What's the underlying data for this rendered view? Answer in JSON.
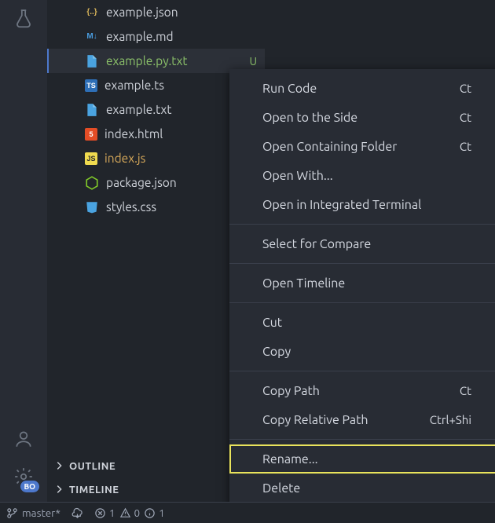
{
  "activity_bar": {
    "top_icon": "flask-icon",
    "bottom_icons": [
      "account-icon",
      "settings-icon"
    ],
    "settings_badge": "BO"
  },
  "files": [
    {
      "name": "example.json",
      "icon": "json",
      "color": "",
      "status": ""
    },
    {
      "name": "example.md",
      "icon": "md",
      "color": "",
      "status": ""
    },
    {
      "name": "example.py.txt",
      "icon": "file",
      "color": "green",
      "status": "U",
      "selected": true
    },
    {
      "name": "example.ts",
      "icon": "ts",
      "color": "",
      "status": ""
    },
    {
      "name": "example.txt",
      "icon": "file",
      "color": "",
      "status": ""
    },
    {
      "name": "index.html",
      "icon": "html",
      "color": "",
      "status": ""
    },
    {
      "name": "index.js",
      "icon": "js",
      "color": "orange",
      "status": ""
    },
    {
      "name": "package.json",
      "icon": "node",
      "color": "",
      "status": ""
    },
    {
      "name": "styles.css",
      "icon": "css",
      "color": "",
      "status": ""
    }
  ],
  "sections": {
    "outline": "OUTLINE",
    "timeline": "TIMELINE"
  },
  "context_menu": [
    {
      "label": "Run Code",
      "shortcut": "Ct"
    },
    {
      "label": "Open to the Side",
      "shortcut": "Ct"
    },
    {
      "label": "Open Containing Folder",
      "shortcut": "Ct"
    },
    {
      "label": "Open With...",
      "shortcut": ""
    },
    {
      "label": "Open in Integrated Terminal",
      "shortcut": ""
    },
    {
      "sep": true
    },
    {
      "label": "Select for Compare",
      "shortcut": ""
    },
    {
      "sep": true
    },
    {
      "label": "Open Timeline",
      "shortcut": ""
    },
    {
      "sep": true
    },
    {
      "label": "Cut",
      "shortcut": ""
    },
    {
      "label": "Copy",
      "shortcut": ""
    },
    {
      "sep": true
    },
    {
      "label": "Copy Path",
      "shortcut": "Ct"
    },
    {
      "label": "Copy Relative Path",
      "shortcut": "Ctrl+Shi"
    },
    {
      "sep": true
    },
    {
      "label": "Rename...",
      "shortcut": "",
      "highlight": true
    },
    {
      "label": "Delete",
      "shortcut": ""
    }
  ],
  "status_bar": {
    "branch": "master*",
    "errors": "1",
    "warnings": "0",
    "info": "1"
  }
}
